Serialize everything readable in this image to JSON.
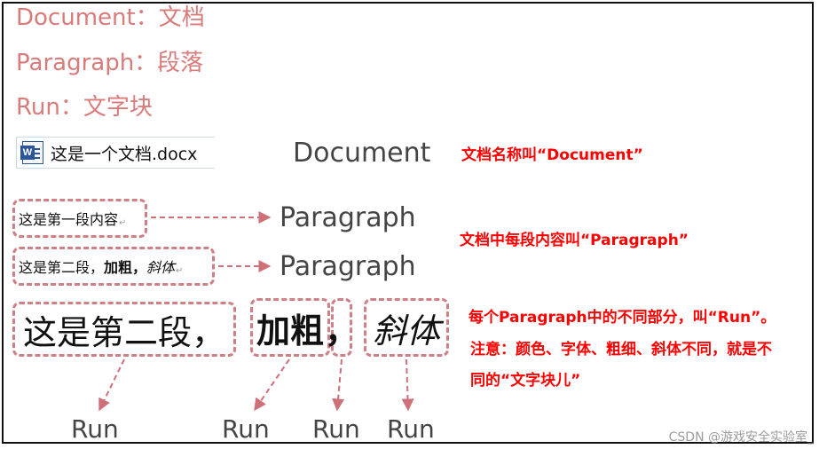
{
  "definitions": [
    "Document：文档",
    "Paragraph：段落",
    "Run：文字块"
  ],
  "file": {
    "icon": "word-document-icon",
    "icon_letter": "W",
    "name": "这是一个文档.docx"
  },
  "labels": {
    "document": "Document",
    "paragraph": "Paragraph",
    "run": "Run"
  },
  "notes": {
    "document": "文档名称叫“Document”",
    "paragraph": "文档中每段内容叫“Paragraph”",
    "run_line1": "每个Paragraph中的不同部分，叫“Run”。",
    "run_line2": "注意：颜色、字体、粗细、斜体不同，就是不",
    "run_line3": "同的“文字块儿”"
  },
  "paragraphs": {
    "first": "这是第一段内容",
    "second_normal": "这是第二段，",
    "second_bold": "加粗，",
    "second_italic": "斜体"
  },
  "runs": {
    "run1": "这是第二段，",
    "run2": "加粗",
    "run3": "，",
    "run4": "斜体"
  },
  "paragraph_mark": "↵",
  "watermark": "CSDN @游戏安全实验室_",
  "colors": {
    "definition_text": "#d97b7b",
    "note_text": "#ff0000",
    "dashed_border": "#cf7f86",
    "arrow": "#cf6f78",
    "label_text": "#444444"
  }
}
